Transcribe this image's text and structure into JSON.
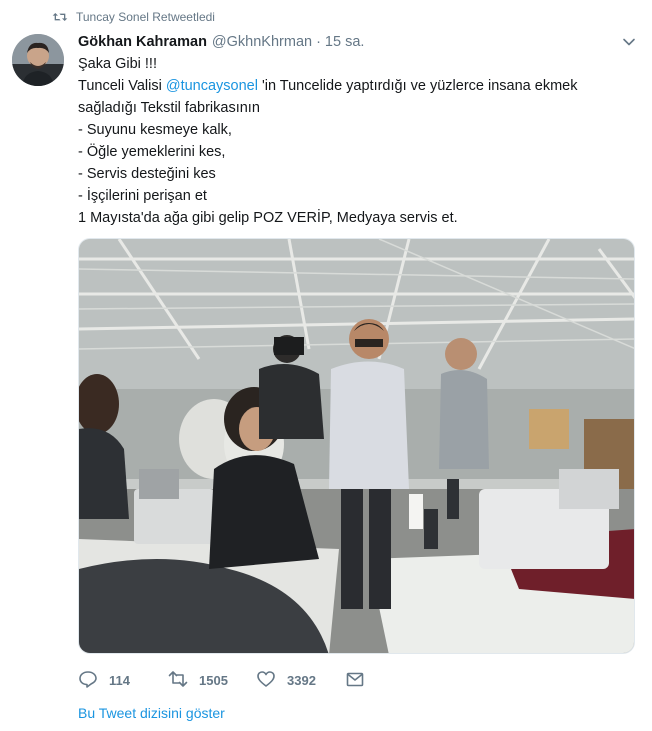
{
  "retweet_context": {
    "label": "Tuncay Sonel Retweetledi"
  },
  "author": {
    "fullname": "Gökhan Kahraman",
    "handle": "@GkhnKhrman",
    "separator": "·",
    "time": "15 sa."
  },
  "tweet": {
    "line1": "Şaka Gibi !!!",
    "line2_prefix": "Tunceli Valisi ",
    "line2_mention": "@tuncaysonel",
    "line2_suffix": " 'in Tuncelide yaptırdığı ve yüzlerce insana ekmek",
    "line3": "sağladığı Tekstil fabrikasının",
    "line4": "- Suyunu kesmeye kalk,",
    "line5": "- Öğle yemeklerini kes,",
    "line6": "- Servis desteğini kes",
    "line7": "- İşçilerini perişan et",
    "line8": "1 Mayısta'da ağa gibi gelip POZ VERİP, Medyaya servis et."
  },
  "actions": {
    "reply_count": "114",
    "retweet_count": "1505",
    "like_count": "3392"
  },
  "show_thread_label": "Bu Tweet dizisini göster",
  "colors": {
    "link": "#1b95e0",
    "secondary_text": "#657786",
    "primary_text": "#14171a"
  },
  "icons": {
    "retweet_context": "retweet-icon",
    "menu": "chevron-down-icon",
    "reply": "reply-icon",
    "retweet": "retweet-icon",
    "like": "heart-icon",
    "message": "envelope-icon"
  }
}
